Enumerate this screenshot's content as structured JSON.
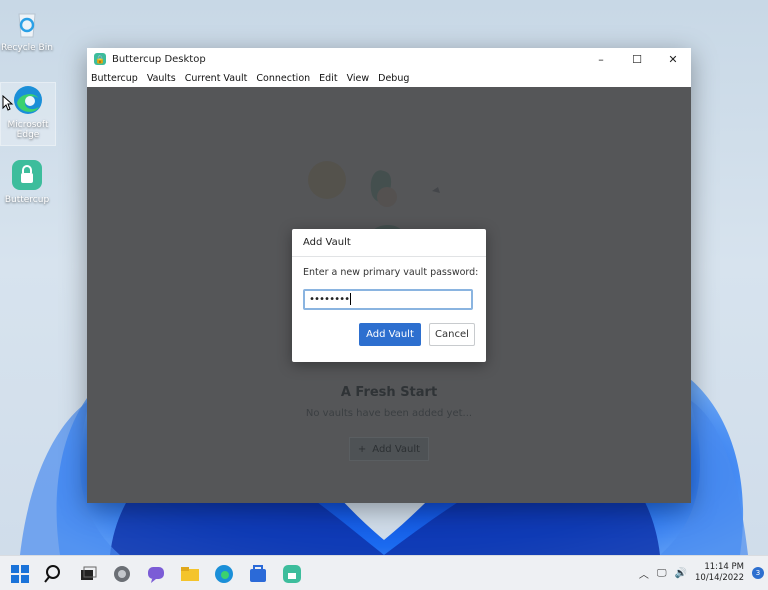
{
  "desktop": {
    "icons": [
      {
        "label": "Recycle Bin"
      },
      {
        "label": "Microsoft Edge"
      },
      {
        "label": "Buttercup"
      }
    ]
  },
  "window": {
    "title": "Buttercup Desktop",
    "controls": {
      "minimize": "–",
      "maximize": "☐",
      "close": "✕"
    },
    "menu": [
      "Buttercup",
      "Vaults",
      "Current Vault",
      "Connection",
      "Edit",
      "View",
      "Debug"
    ]
  },
  "main": {
    "heading": "A Fresh Start",
    "subtext": "No vaults have been added yet...",
    "add_vault_label": "Add Vault",
    "add_vault_icon": "plus-icon"
  },
  "dialog": {
    "title": "Add Vault",
    "label": "Enter a new primary vault password:",
    "password_value": "••••••••",
    "primary_button": "Add Vault",
    "cancel_button": "Cancel"
  },
  "taskbar": {
    "time": "11:14 PM",
    "date": "10/14/2022",
    "notification_count": "3"
  },
  "colors": {
    "accent": "#2d6fcf",
    "buttercup_brand": "#3dbd9c"
  }
}
